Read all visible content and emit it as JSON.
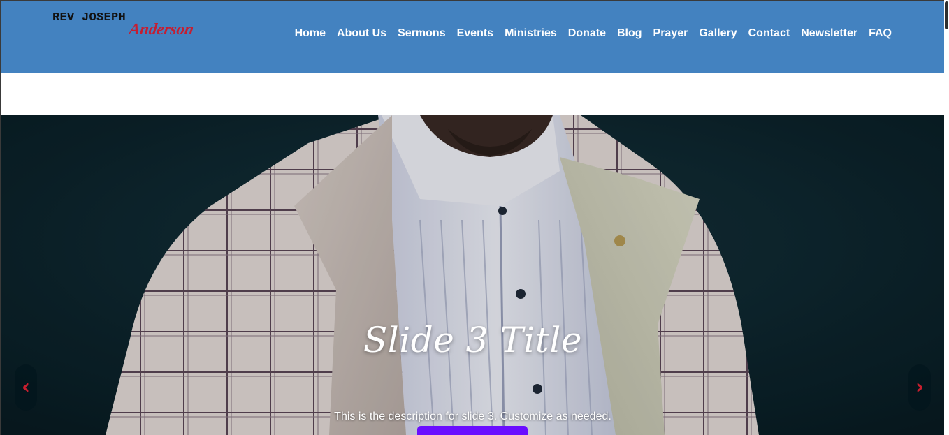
{
  "logo": {
    "line1": "REV JOSEPH",
    "line2": "Anderson"
  },
  "nav": {
    "items": [
      {
        "label": "Home"
      },
      {
        "label": "About Us"
      },
      {
        "label": "Sermons"
      },
      {
        "label": "Events"
      },
      {
        "label": "Ministries"
      },
      {
        "label": "Donate"
      },
      {
        "label": "Blog"
      },
      {
        "label": "Prayer"
      },
      {
        "label": "Gallery"
      },
      {
        "label": "Contact"
      },
      {
        "label": "Newsletter"
      },
      {
        "label": "FAQ"
      }
    ]
  },
  "slider": {
    "title": "Slide 3 Title",
    "description": "This is the description for slide 3. Customize as needed.",
    "prev_icon": "‹",
    "next_icon": "›"
  },
  "colors": {
    "header_bg": "#4382c0",
    "logo_accent": "#c41e32",
    "arrow": "#c81e2e",
    "cta": "#6a0dff"
  }
}
